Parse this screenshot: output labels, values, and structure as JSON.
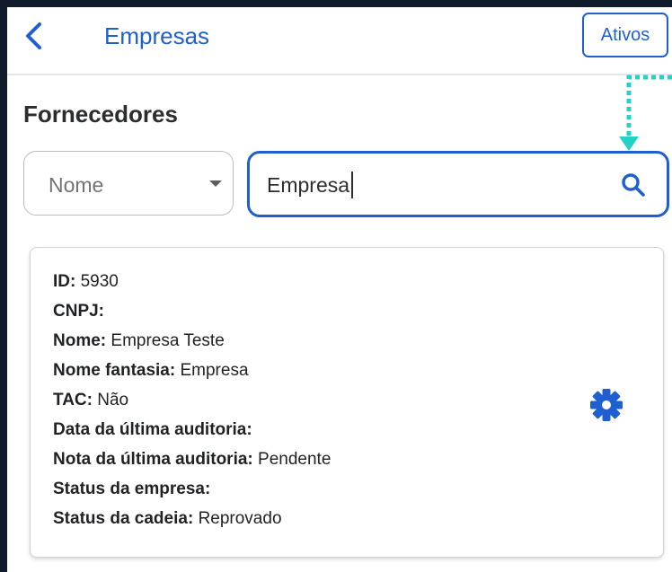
{
  "header": {
    "title": "Empresas",
    "back_icon": "chevron-left-icon",
    "ativos_label": "Ativos"
  },
  "section": {
    "title": "Fornecedores"
  },
  "filter": {
    "field_select_value": "Nome",
    "search_value": "Empresa",
    "search_icon": "search-icon"
  },
  "card": {
    "id": {
      "label": "ID:",
      "value": "5930"
    },
    "cnpj": {
      "label": "CNPJ:",
      "value": ""
    },
    "nome": {
      "label": "Nome:",
      "value": "Empresa Teste"
    },
    "nome_fantasia": {
      "label": "Nome fantasia:",
      "value": "Empresa"
    },
    "tac": {
      "label": "TAC:",
      "value": "Não"
    },
    "data_ultima_auditoria": {
      "label": "Data da última auditoria:",
      "value": ""
    },
    "nota_ultima_auditoria": {
      "label": "Nota da última auditoria:",
      "value": "Pendente"
    },
    "status_empresa": {
      "label": "Status da empresa:",
      "value": ""
    },
    "status_cadeia": {
      "label": "Status da cadeia:",
      "value": "Reprovado"
    },
    "settings_icon": "gear-icon"
  },
  "colors": {
    "primary": "#1f5fd1",
    "annotation_arrow": "#22d3c5",
    "background_frame": "#0f1b2b"
  }
}
